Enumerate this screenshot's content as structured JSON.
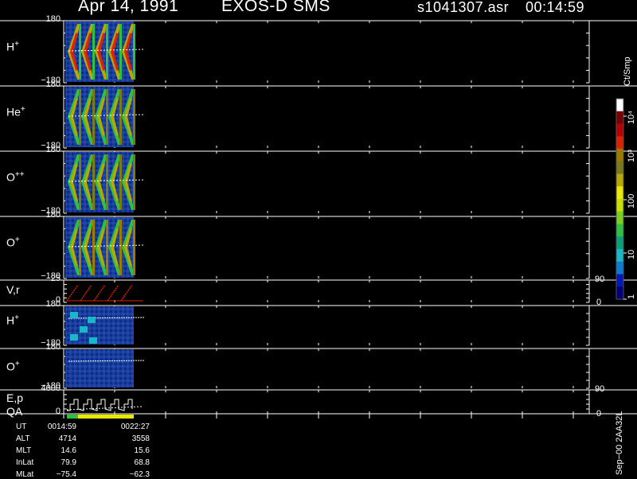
{
  "header": {
    "date": "Apr 14, 1991",
    "instrument": "EXOS-D SMS",
    "file": "s1041307.asr",
    "time": "00:14:59"
  },
  "panels": [
    {
      "label": "H",
      "sup": "+",
      "ytop": "180",
      "ybot": "−180"
    },
    {
      "label": "He",
      "sup": "+",
      "ytop": "180",
      "ybot": "−180"
    },
    {
      "label": "O",
      "sup": "++",
      "ytop": "180",
      "ybot": "−180"
    },
    {
      "label": "O",
      "sup": "+",
      "ytop": "180",
      "ybot": "−180"
    },
    {
      "label": "V,r",
      "sup": "",
      "ytop": "25",
      "ybot": "0",
      "rtop": "90",
      "rbot": "0"
    },
    {
      "label": "H",
      "sup": "+",
      "ytop": "180",
      "ybot": "−180"
    },
    {
      "label": "O",
      "sup": "+",
      "ytop": "180",
      "ybot": "−180"
    },
    {
      "label": "E,p",
      "sup": "",
      "ytop": "4000",
      "ybot": "0",
      "rtop": "90",
      "rbot": "0"
    }
  ],
  "qa_label": "QA",
  "colorbar": {
    "title": "Ct/Smp",
    "ticks": [
      "1",
      "10",
      "100",
      "10³",
      "10⁴"
    ],
    "colors": [
      "#00007a",
      "#0018b8",
      "#0a7bd6",
      "#18b8c8",
      "#08a078",
      "#30c040",
      "#78d020",
      "#c8e000",
      "#e8e800",
      "#b8a800",
      "#7a7a18",
      "#a07a00",
      "#e02000",
      "#b80000",
      "#7a0000",
      "#ffffff"
    ]
  },
  "footer": {
    "rows": [
      {
        "name": "UT",
        "v1": "0014:59",
        "v2": "0022:27"
      },
      {
        "name": "ALT",
        "v1": "4714",
        "v2": "3558"
      },
      {
        "name": "MLT",
        "v1": "14.6",
        "v2": "15.6"
      },
      {
        "name": "InLat",
        "v1": "79.9",
        "v2": "68.8"
      },
      {
        "name": "MLat",
        "v1": "−75.4",
        "v2": "−62.3"
      }
    ],
    "side_id": "Sep−00  2AA32L"
  },
  "chart_data": {
    "type": "heatmap",
    "x_range_ut": [
      "0014:59",
      "0022:27"
    ],
    "panels": [
      {
        "species": "H+",
        "ylim": [
          -180,
          180
        ]
      },
      {
        "species": "He+",
        "ylim": [
          -180,
          180
        ]
      },
      {
        "species": "O++",
        "ylim": [
          -180,
          180
        ]
      },
      {
        "species": "O+",
        "ylim": [
          -180,
          180
        ]
      },
      {
        "quantity": "V,r",
        "ylim": [
          0,
          25
        ],
        "ylim_right": [
          0,
          90
        ]
      },
      {
        "species": "H+",
        "ylim": [
          -180,
          180
        ]
      },
      {
        "species": "O+",
        "ylim": [
          -180,
          180
        ]
      },
      {
        "quantity": "E,p",
        "ylim": [
          0,
          4000
        ],
        "ylim_right": [
          0,
          90
        ]
      }
    ],
    "colorbar_range": [
      1,
      10000
    ],
    "colorbar_scale": "log"
  }
}
